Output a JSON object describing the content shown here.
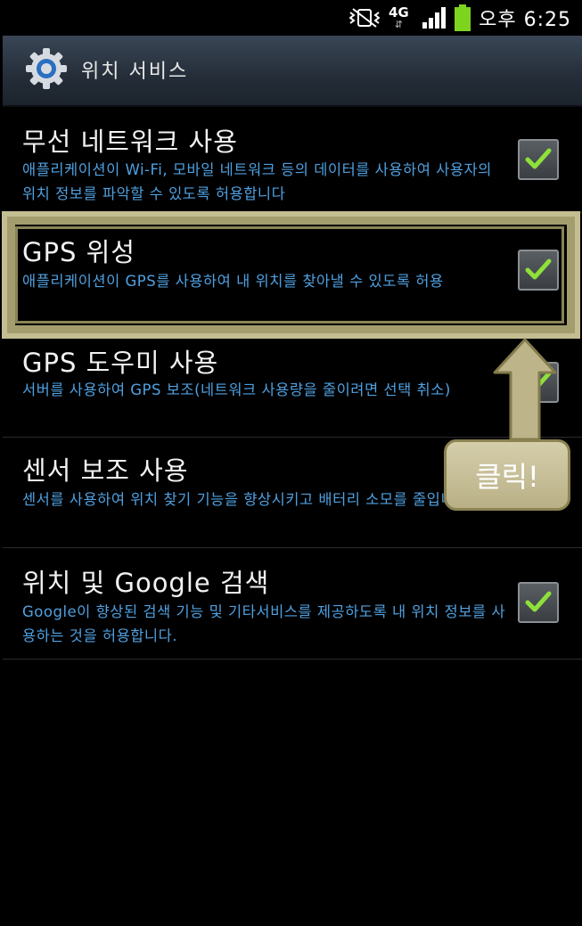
{
  "status_bar": {
    "network": "4G",
    "network_arrows": "⇵",
    "time": "오후 6:25",
    "battery_color": "#7ed321"
  },
  "header": {
    "title": "위치 서비스",
    "icon": "gear-icon"
  },
  "settings": [
    {
      "title": "무선 네트워크 사용",
      "description": "애플리케이션이 Wi-Fi, 모바일 네트워크 등의 데이터를 사용하여 사용자의 위치 정보를 파악할 수 있도록 허용합니다",
      "checked": true
    },
    {
      "title": "GPS 위성",
      "description": "애플리케이션이 GPS를 사용하여 내 위치를 찾아낼 수 있도록 허용",
      "checked": true
    },
    {
      "title": "GPS 도우미 사용",
      "description": "서버를 사용하여 GPS 보조(네트워크 사용량을 줄이려면 선택 취소)",
      "checked": true
    },
    {
      "title": "센서 보조 사용",
      "description": "센서를 사용하여 위치 찾기 기능을 향상시키고 배터리 소모를 줄입니다",
      "checked": true
    },
    {
      "title": "위치 및 Google 검색",
      "description": "Google이 향상된 검색 기능 및 기타서비스를 제공하도록 내 위치 정보를 사용하는 것을 허용합니다.",
      "checked": true
    }
  ],
  "annotation": {
    "callout_text": "클릭!",
    "highlight_color": "#c3bd92"
  }
}
